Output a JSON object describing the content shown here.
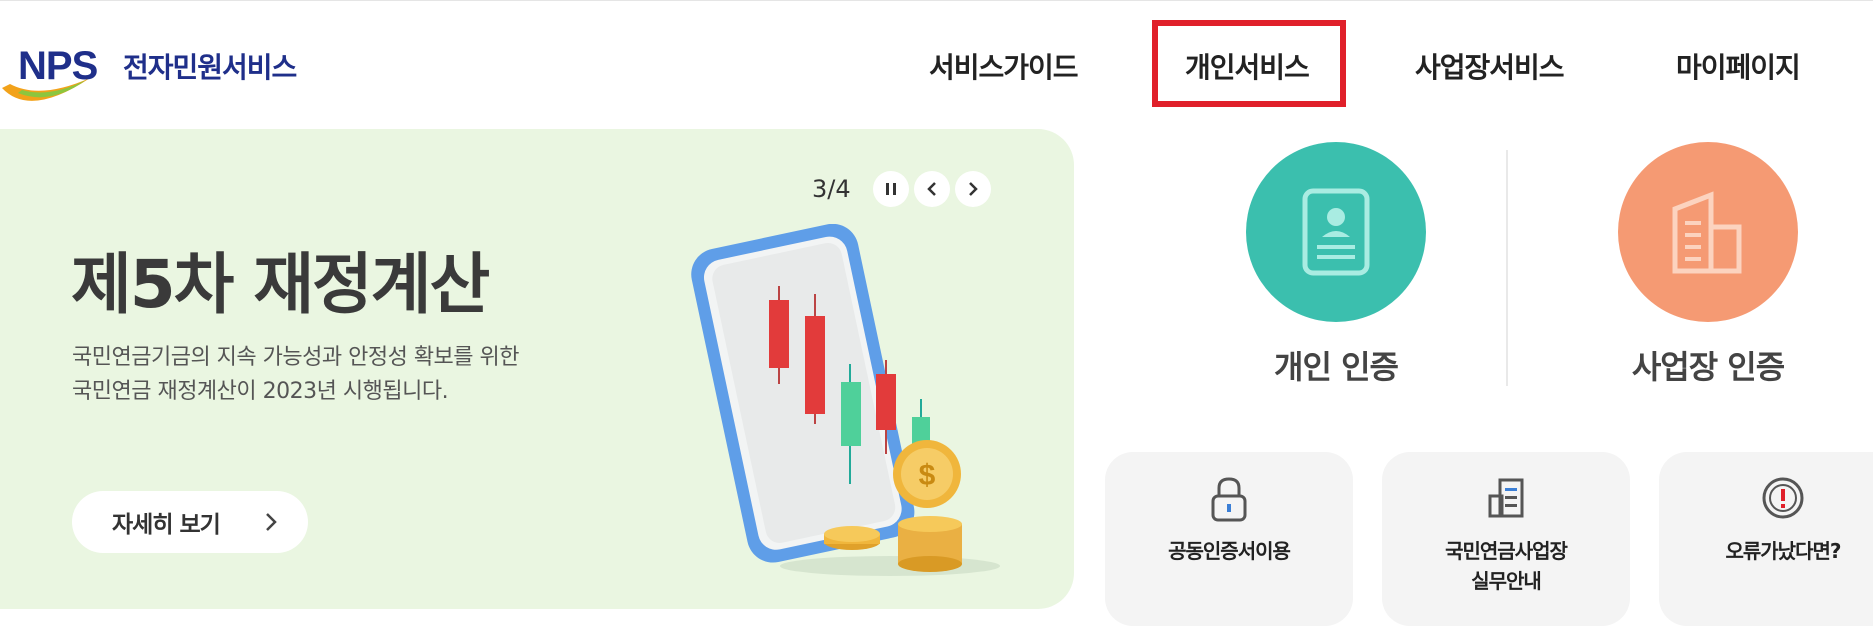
{
  "header": {
    "logo_mark": "NPS",
    "logo_text": "전자민원서비스",
    "nav": [
      "서비스가이드",
      "개인서비스",
      "사업장서비스",
      "마이페이지"
    ]
  },
  "banner": {
    "counter": "3/4",
    "title": "제5차 재정계산",
    "desc_line1": "국민연금기금의 지속 가능성과 안정성 확보를 위한",
    "desc_line2": "국민연금 재정계산이 2023년 시행됩니다.",
    "detail_label": "자세히 보기",
    "background_color": "#eaf6e1"
  },
  "auth": {
    "personal_label": "개인 인증",
    "personal_color": "#3bbfae",
    "business_label": "사업장 인증",
    "business_color": "#f59a73"
  },
  "quick_links": {
    "cert": "공동인증서이용",
    "guide_line1": "국민연금사업장",
    "guide_line2": "실무안내",
    "error": "오류가났다면?"
  },
  "colors": {
    "brand": "#1f2f8a",
    "highlight": "#e0202a"
  }
}
